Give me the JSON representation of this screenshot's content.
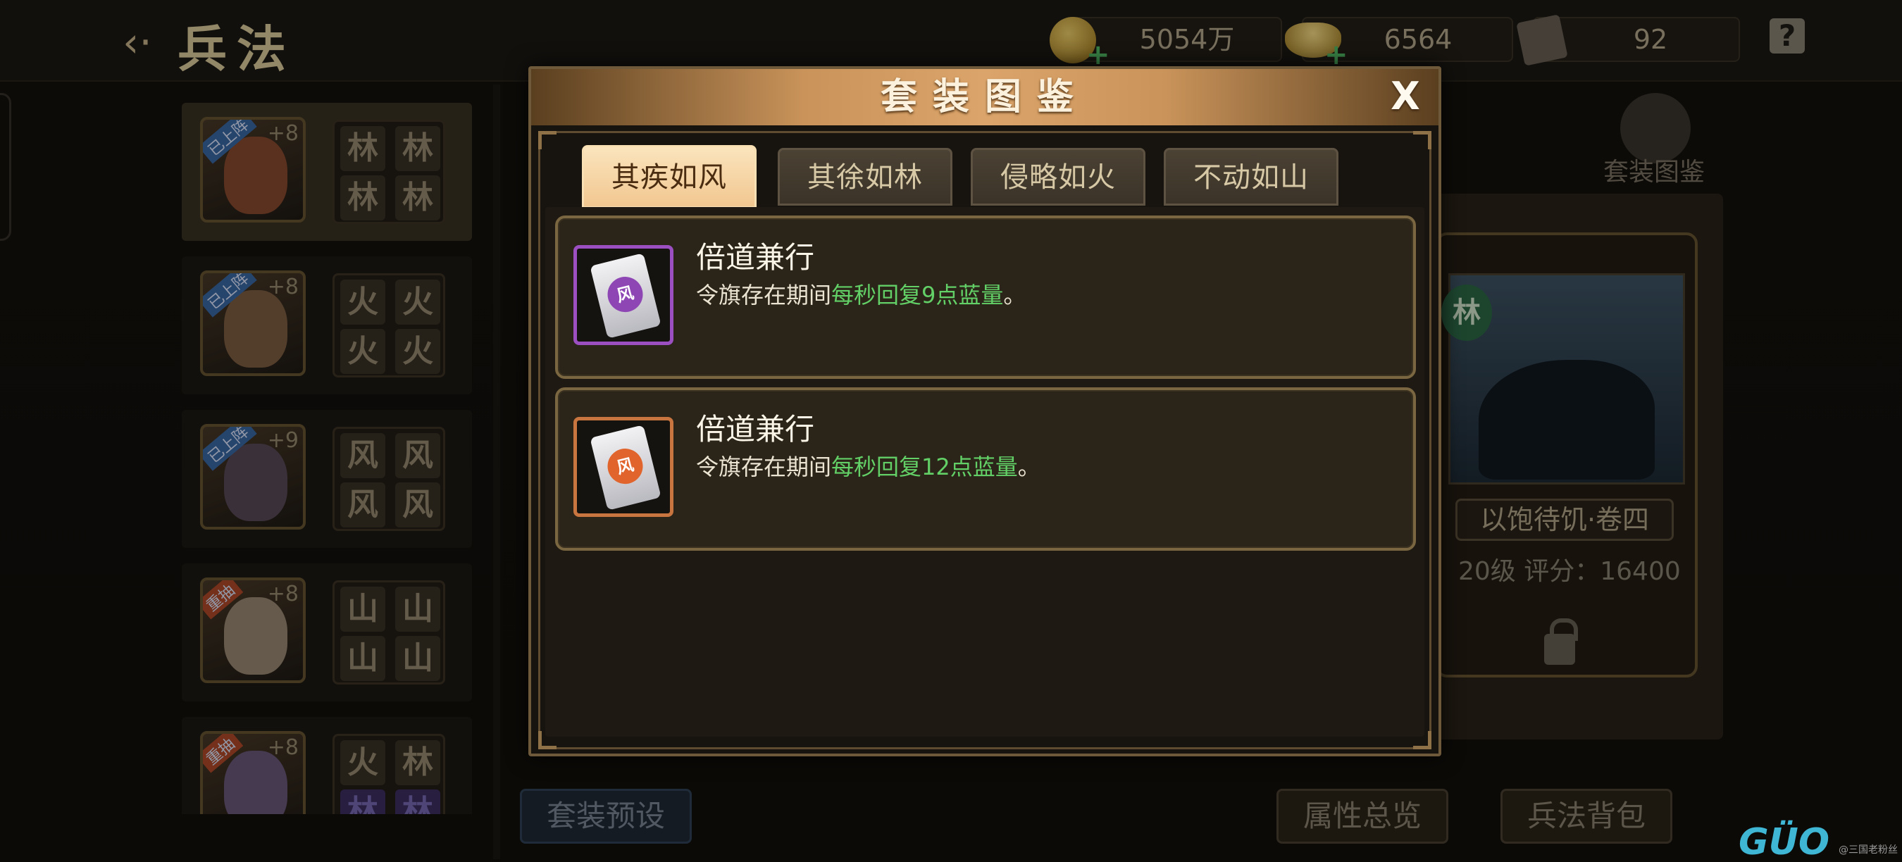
{
  "header": {
    "title": "兵法"
  },
  "resources": [
    {
      "icon": "gold-coin-icon",
      "value": "5054万"
    },
    {
      "icon": "gold-ingot-icon",
      "value": "6564"
    },
    {
      "icon": "scroll-icon",
      "value": "92"
    }
  ],
  "help": "?",
  "heroes": [
    {
      "level": "+8",
      "badge": "已上阵",
      "cells": [
        "林",
        "林",
        "林",
        "林"
      ]
    },
    {
      "level": "+8",
      "badge": "已上阵",
      "cells": [
        "火",
        "火",
        "火",
        "火"
      ]
    },
    {
      "level": "+9",
      "badge": "已上阵",
      "cells": [
        "风",
        "风",
        "风",
        "风"
      ]
    },
    {
      "level": "+8",
      "badge": "重抽",
      "cells": [
        "山",
        "山",
        "山",
        "山"
      ]
    },
    {
      "level": "+8",
      "badge": "重抽",
      "cells": [
        "火",
        "林",
        "林",
        "林"
      ]
    }
  ],
  "right_panel": {
    "atlas_label": "套装图鉴",
    "card_badge": "林",
    "card_name": "以饱待饥·卷四",
    "card_score": "20级  评分：16400"
  },
  "bottom_buttons": {
    "preset": "套装预设",
    "overview": "属性总览",
    "bag": "兵法背包"
  },
  "watermark": {
    "logo": "GÜO",
    "text": "@三国老粉丝"
  },
  "modal": {
    "title": "套装图鉴",
    "close": "X",
    "tabs": [
      "其疾如风",
      "其徐如林",
      "侵略如火",
      "不动如山"
    ],
    "active_tab": 0,
    "entries": [
      {
        "name": "倍道兼行",
        "desc_prefix": "令旗存在期间",
        "desc_highlight": "每秒回复9点蓝量",
        "desc_suffix": "。",
        "emblem": "风",
        "frame_color": "#9b4fc0"
      },
      {
        "name": "倍道兼行",
        "desc_prefix": "令旗存在期间",
        "desc_highlight": "每秒回复12点蓝量",
        "desc_suffix": "。",
        "emblem": "风",
        "frame_color": "#c8753f"
      }
    ],
    "highlight_color": "#62d066"
  }
}
